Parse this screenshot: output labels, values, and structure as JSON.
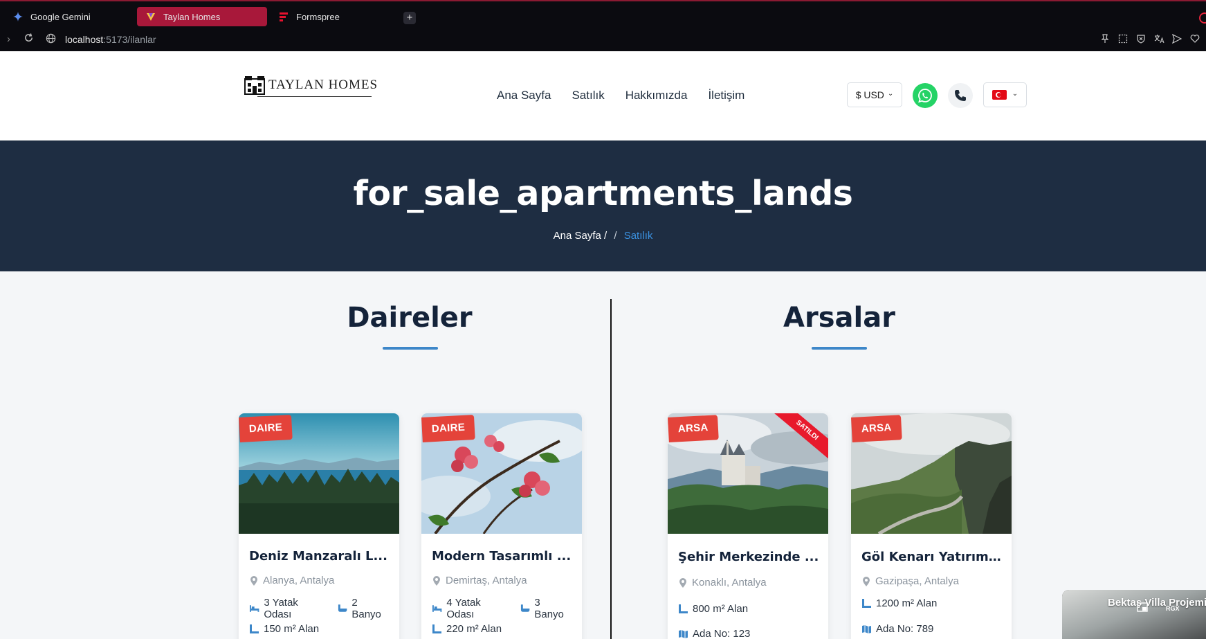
{
  "browser": {
    "tabs": [
      {
        "label": "Google Gemini",
        "icon": "gemini-icon",
        "active": false
      },
      {
        "label": "Taylan Homes",
        "icon": "taylan-favicon-icon",
        "active": true
      },
      {
        "label": "Formspree",
        "icon": "formspree-icon",
        "active": false
      }
    ],
    "new_tab_label": "+",
    "url_host": "localhost",
    "url_path": ":5173/ilanlar"
  },
  "header": {
    "logo_text": "TAYLAN HOMES",
    "nav": [
      "Ana Sayfa",
      "Satılık",
      "Hakkımızda",
      "İletişim"
    ],
    "currency_label": "$ USD",
    "currency_chevron": "⌄",
    "lang_chevron": "⌄"
  },
  "hero": {
    "title": "for_sale_apartments_lands",
    "breadcrumb_home": "Ana Sayfa /",
    "breadcrumb_sep": "/",
    "breadcrumb_current": "Satılık"
  },
  "sections": {
    "apartments_title": "Daireler",
    "lands_title": "Arsalar"
  },
  "apartments": [
    {
      "badge": "DAIRE",
      "title": "Deniz Manzaralı L...",
      "location": "Alanya, Antalya",
      "beds": "3 Yatak Odası",
      "baths": "2 Banyo",
      "area": "150 m² Alan"
    },
    {
      "badge": "DAIRE",
      "title": "Modern Tasarımlı ...",
      "location": "Demirtaş, Antalya",
      "beds": "4 Yatak Odası",
      "baths": "3 Banyo",
      "area": "220 m² Alan"
    }
  ],
  "lands": [
    {
      "badge": "ARSA",
      "sold": "SATILDI",
      "title": "Şehir Merkezinde ...",
      "location": "Konaklı, Antalya",
      "area": "800 m² Alan",
      "parcel": "Ada No: 123"
    },
    {
      "badge": "ARSA",
      "title": "Göl Kenarı Yatırım ...",
      "location": "Gazipaşa, Antalya",
      "area": "1200 m² Alan",
      "parcel": "Ada No: 789"
    }
  ],
  "floating_video": {
    "title": "Bektaş Villa Projemiz",
    "tag": "RGX"
  },
  "colors": {
    "hero_bg": "#1e2d42",
    "accent_blue": "#3d87c9",
    "badge_red": "#e4433a",
    "whatsapp_green": "#25d366",
    "active_tab": "#a8183a"
  }
}
